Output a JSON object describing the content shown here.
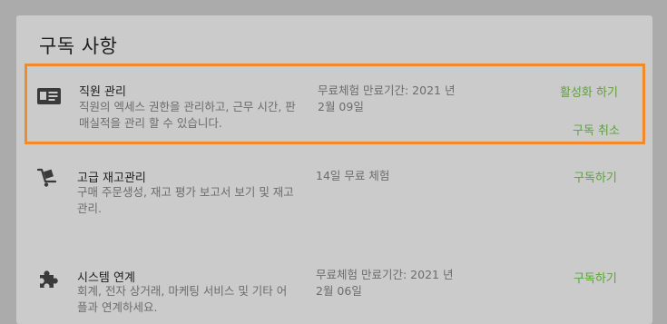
{
  "card": {
    "title": "구독 사항"
  },
  "subscriptions": [
    {
      "icon": "id-card-icon",
      "name": "직원 관리",
      "description": "직원의 엑세스 권한을 관리하고, 근무 시간, 판매실적을 관리 할 수 있습니다.",
      "status": "무료체험 만료기간: 2021 년 2월 09일",
      "primary_action": "활성화 하기",
      "secondary_action": "구독 취소",
      "highlighted": true
    },
    {
      "icon": "hand-truck-icon",
      "name": "고급 재고관리",
      "description": "구매 주문생성, 재고 평가 보고서 보기 및 재고 관리.",
      "status": "14일 무료 체험",
      "primary_action": "구독하기"
    },
    {
      "icon": "puzzle-piece-icon",
      "name": "시스템 연계",
      "description": "회계, 전자 상거래, 마케팅 서비스 및 기타 어플과 연계하세요.",
      "status": "무료체험 만료기간: 2021 년 2월 06일",
      "primary_action": "구독하기"
    }
  ],
  "colors": {
    "backdrop": "#ababab",
    "card": "#cbcbcb",
    "accent_green": "#5aa23d",
    "highlight_border": "#ef8a2d"
  }
}
